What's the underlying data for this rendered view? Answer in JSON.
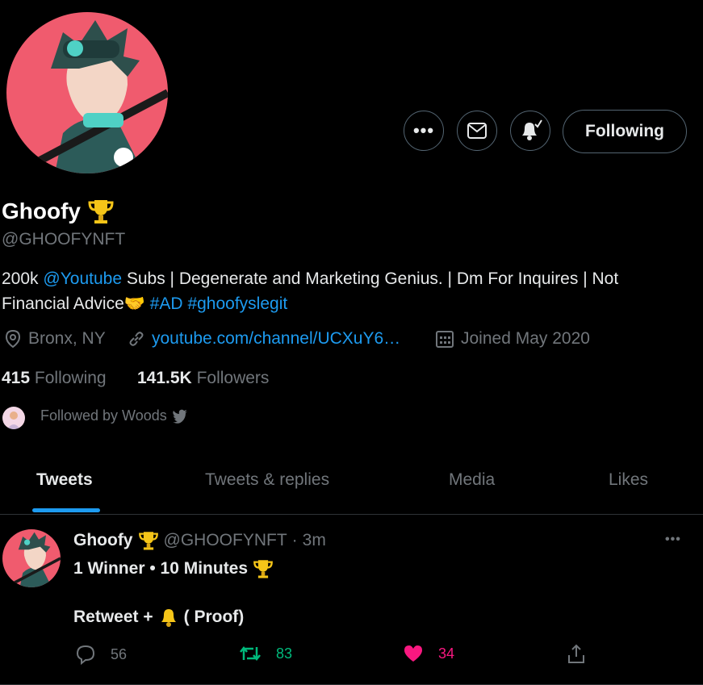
{
  "profile": {
    "name": "Ghoofy",
    "handle": "@GHOOFYNFT",
    "bio_part1": "200k ",
    "bio_mention": "@Youtube",
    "bio_part2": " Subs | Degenerate and Marketing Genius. | Dm For Inquires | Not Financial Advice",
    "bio_hashtag1": "#AD",
    "bio_hashtag2": "#ghoofyslegit",
    "location": "Bronx, NY",
    "website": "youtube.com/channel/UCXuY6…",
    "joined": "Joined May 2020",
    "following_count": "415",
    "following_label": "Following",
    "followers_count": "141.5K",
    "followers_label": "Followers",
    "followed_by": "Followed by Woods"
  },
  "actions": {
    "follow_button": "Following"
  },
  "tabs": [
    {
      "label": "Tweets"
    },
    {
      "label": "Tweets & replies"
    },
    {
      "label": "Media"
    },
    {
      "label": "Likes"
    }
  ],
  "tweet": {
    "name": "Ghoofy",
    "handle": "@GHOOFYNFT",
    "sep": "·",
    "time": "3m",
    "line1": "1 Winner • 10 Minutes",
    "line2a": "Retweet +",
    "line2b": "( Proof)",
    "replies": "56",
    "retweets": "83",
    "likes": "34"
  },
  "colors": {
    "accent": "#1d9bf0",
    "retweet": "#00ba7c",
    "like": "#f91880",
    "tab_indicator": "#1d9bf0"
  }
}
